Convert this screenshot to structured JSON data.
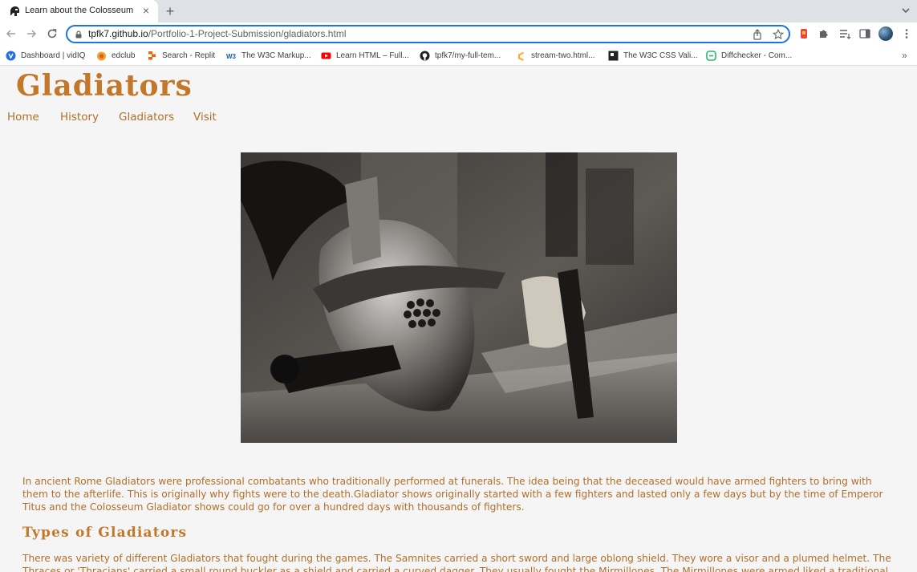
{
  "browser": {
    "tab": {
      "title": "Learn about the Colosseum",
      "close": "×",
      "favicon": "spartan-helmet-icon"
    },
    "new_tab": "+",
    "url": {
      "host": "tpfk7.github.io",
      "path": "/Portfolio-1-Project-Submission/gladiators.html"
    },
    "bookmarks": [
      {
        "label": "Dashboard | vidIQ",
        "icon": "vidiq-icon",
        "color": "#1f6fe0"
      },
      {
        "label": "edclub",
        "icon": "edclub-icon",
        "color": "#f0a030"
      },
      {
        "label": "Search - Replit",
        "icon": "replit-icon",
        "color": "#f26207"
      },
      {
        "label": "The W3C Markup...",
        "icon": "w3c-icon",
        "color": "#1a5aa0"
      },
      {
        "label": "Learn HTML – Full...",
        "icon": "youtube-icon",
        "color": "#ff0000"
      },
      {
        "label": "tpfk7/my-full-tem...",
        "icon": "github-icon",
        "color": "#202124"
      },
      {
        "label": "stream-two.html...",
        "icon": "gitpod-icon",
        "color": "#ffae33"
      },
      {
        "label": "The W3C CSS Vali...",
        "icon": "w3c-css-icon",
        "color": "#202124"
      },
      {
        "label": "Diffchecker - Com...",
        "icon": "diffchecker-icon",
        "color": "#2bb673"
      }
    ],
    "bookmarks_more": "»"
  },
  "site": {
    "title": "Gladiators",
    "nav": [
      "Home",
      "History",
      "Gladiators",
      "Visit"
    ],
    "hero_image": "gladiator-helmet-photo",
    "intro": "In ancient Rome Gladiators were professional combatants who traditionally performed at funerals. The idea being that the deceased would have armed fighters to bring with them to the afterlife. This is originally why fights were to the death.Gladiator shows originally started with a few fighters and lasted only a few days but by the time of Emperor Titus and the Colosseum Gladiator shows could go for over a hundred days with thousands of fighters.",
    "types_heading": "Types of Gladiators",
    "types_text": "There was variety of different Gladiators that fought during the games. The Samnites carried a short sword and large oblong shield. They wore a visor and a plumed helmet. The Thraces or 'Thracians' carried a small round buckler as a shield and carried a curved dagger. They usually fought the Mirmillones. The Mirmillones were armed liked a traditional Gallic fighter, with a"
  },
  "colors": {
    "accent": "#c1782b",
    "link": "#b06f2a",
    "omnibox_focus": "#1a73e8",
    "page_bg": "#f6f5f5"
  }
}
